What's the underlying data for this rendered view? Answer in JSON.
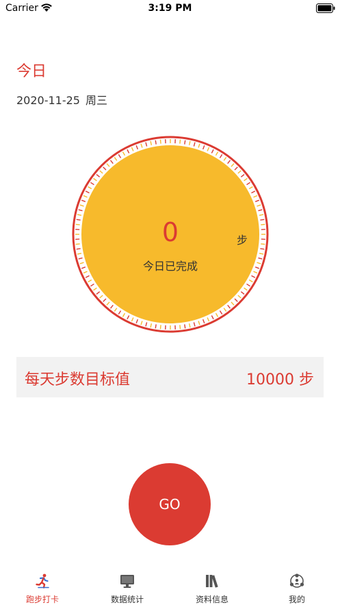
{
  "status_bar": {
    "carrier": "Carrier",
    "time": "3:19 PM"
  },
  "header": {
    "title": "今日",
    "date": "2020-11-25",
    "weekday": "周三"
  },
  "dial": {
    "steps": "0",
    "unit": "步",
    "label": "今日已完成",
    "progress_fraction": 0
  },
  "goal": {
    "label": "每天步数目标值",
    "value": "10000 步"
  },
  "go_button": {
    "label": "GO"
  },
  "tabs": [
    {
      "label": "跑步打卡",
      "icon": "runner-icon",
      "active": true
    },
    {
      "label": "数据统计",
      "icon": "monitor-icon",
      "active": false
    },
    {
      "label": "资料信息",
      "icon": "books-icon",
      "active": false
    },
    {
      "label": "我的",
      "icon": "people-network-icon",
      "active": false
    }
  ],
  "colors": {
    "accent": "#db3b32",
    "dial_fill": "#f7ba2c",
    "goal_bg": "#f2f2f2"
  }
}
